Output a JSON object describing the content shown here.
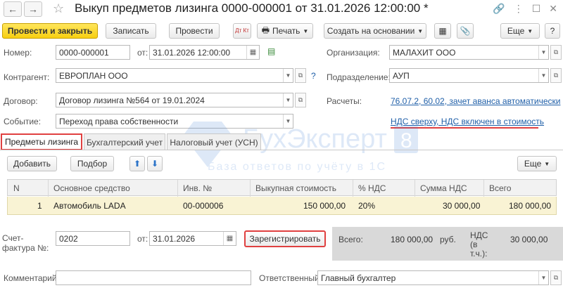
{
  "window": {
    "title": "Выкуп предметов лизинга 0000-000001 от 31.01.2026 12:00:00 *",
    "back_icon": "arrow-left-icon",
    "forward_icon": "arrow-right-icon",
    "favorite_icon": "star-icon"
  },
  "toolbar": {
    "post_close": "Провести и закрыть",
    "save": "Записать",
    "post": "Провести",
    "dtkt": "Дт Кт",
    "print": "Печать",
    "create_based": "Создать на основании",
    "more": "Еще"
  },
  "header": {
    "number_label": "Номер:",
    "number_value": "0000-000001",
    "date_from_label": "от:",
    "date_value": "31.01.2026 12:00:00",
    "org_label": "Организация:",
    "org_value": "МАЛАХИТ ООО",
    "counterparty_label": "Контрагент:",
    "counterparty_value": "ЕВРОПЛАН ООО",
    "question_mark": "?",
    "division_label": "Подразделение:",
    "division_value": "АУП",
    "contract_label": "Договор:",
    "contract_value": "Договор лизинга №564 от 19.01.2024",
    "settlements_label": "Расчеты:",
    "settlements_link": "76.07.2, 60.02, зачет аванса автоматически",
    "event_label": "Событие:",
    "event_value": "Переход права собственности",
    "vat_link": "НДС сверху, НДС включен в стоимость"
  },
  "tabs": [
    {
      "label": "Предметы лизинга"
    },
    {
      "label": "Бухгалтерский учет"
    },
    {
      "label": "Налоговый учет (УСН)"
    }
  ],
  "table_toolbar": {
    "add": "Добавить",
    "pick": "Подбор",
    "more": "Еще"
  },
  "table": {
    "columns": [
      "N",
      "Основное средство",
      "Инв. №",
      "Выкупная стоимость",
      "% НДС",
      "Сумма НДС",
      "Всего"
    ],
    "rows": [
      [
        "1",
        "Автомобиль LADA",
        "00-000006",
        "150 000,00",
        "20%",
        "30 000,00",
        "180 000,00"
      ]
    ]
  },
  "footer": {
    "invoice_label": "Счет-фактура №:",
    "invoice_number": "0202",
    "invoice_date_label": "от:",
    "invoice_date": "31.01.2026",
    "register_button": "Зарегистрировать",
    "total_label": "Всего:",
    "total_value": "180 000,00",
    "currency": "руб.",
    "vat_label": "НДС (в т.ч.):",
    "vat_value": "30 000,00",
    "comment_label": "Комментарий:",
    "comment_value": "",
    "responsible_label": "Ответственный:",
    "responsible_value": "Главный бухгалтер"
  },
  "watermark": {
    "brand": "БухЭксперт",
    "digit": "8",
    "tagline": "База ответов по учёту в 1С"
  },
  "colors": {
    "primary_button": "#f7cf10",
    "link": "#1f5fa8",
    "highlight_red": "#e04040",
    "row_selected": "#f9f3d4"
  }
}
